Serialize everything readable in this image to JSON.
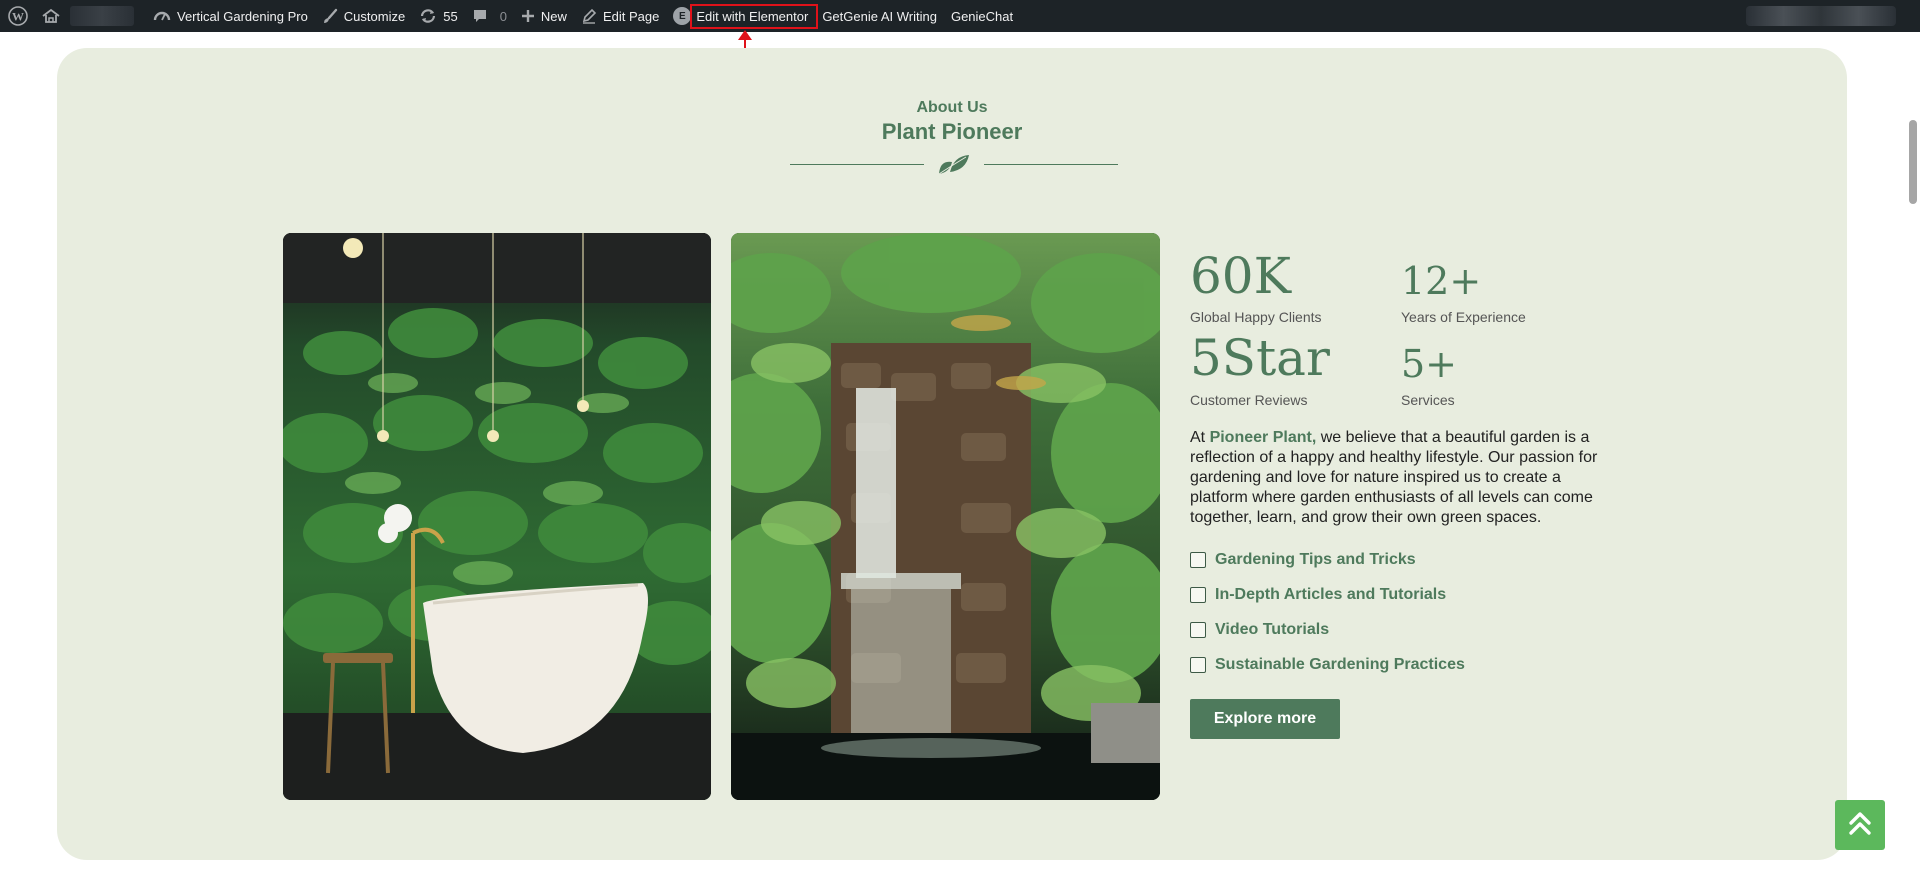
{
  "adminbar": {
    "site_name": "Vertical Gardening Pro",
    "customize": "Customize",
    "updates_count": "55",
    "comments_count": "0",
    "new": "New",
    "edit_page": "Edit Page",
    "elementor_badge": "E",
    "edit_elementor": "Edit with Elementor",
    "getgenie": "GetGenie AI Writing",
    "geniechat": "GenieChat"
  },
  "about": {
    "label": "About Us",
    "title": "Plant Pioneer"
  },
  "stats": [
    {
      "value": "60K",
      "label": "Global Happy Clients"
    },
    {
      "value": "12+",
      "label": "Years of Experience"
    },
    {
      "value": "5Star",
      "label": "Customer Reviews"
    },
    {
      "value": "5+",
      "label": "Services"
    }
  ],
  "description": {
    "prefix": "At ",
    "brand": "Pioneer Plant,",
    "body": " we believe that a beautiful garden is a reflection of a happy and healthy lifestyle. Our passion for gardening and love for nature inspired us to create a platform where garden enthusiasts of all levels can come together, learn, and grow their own green spaces."
  },
  "features": [
    "Gardening Tips and Tricks",
    "In-Depth Articles and Tutorials",
    "Video Tutorials",
    "Sustainable Gardening Practices"
  ],
  "explore_button": "Explore more",
  "icons": {
    "wordpress": "wordpress-logo-icon",
    "site": "site-home-icon",
    "customize": "paintbrush-icon",
    "updates": "refresh-icon",
    "comments": "comment-icon",
    "new": "plus-icon",
    "edit": "pencil-icon",
    "divider": "leaf-icon",
    "back_to_top": "double-chevron-up-icon"
  },
  "colors": {
    "adminbar": "#1d2327",
    "section_bg": "#e8eddf",
    "accent_green": "#4e7a5c",
    "highlight_red": "#e0121a",
    "back_to_top": "#5cb85c"
  }
}
